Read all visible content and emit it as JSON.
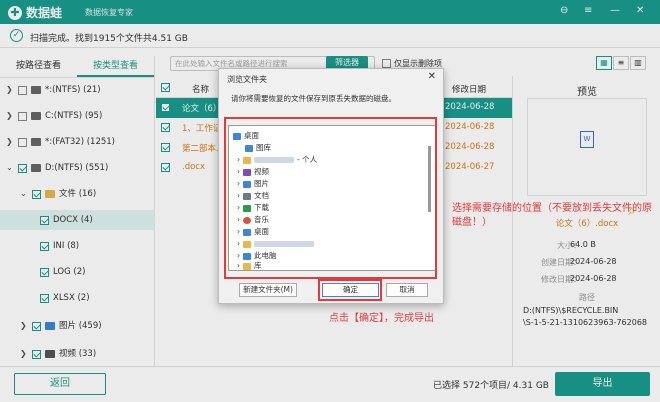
{
  "app": {
    "name": "数据蛙",
    "subtitle": "数据恢复专家"
  },
  "window_controls": [
    "⊖",
    "≡",
    "—",
    "✕"
  ],
  "status": {
    "text": "扫描完成。找到1915个文件共4.51 GB"
  },
  "left_tabs": [
    "按路径查看",
    "按类型查看"
  ],
  "tree": [
    {
      "label": "*:(NTFS) (21)",
      "checked": false
    },
    {
      "label": "C:(NTFS) (95)",
      "checked": false
    },
    {
      "label": "*:(FAT32) (1251)",
      "checked": false
    },
    {
      "label": "D:(NTFS) (551)",
      "checked": true
    },
    {
      "label": "文件 (16)",
      "checked": true
    },
    {
      "label": "DOCX (4)",
      "checked": true
    },
    {
      "label": "INI (8)",
      "checked": true
    },
    {
      "label": "LOG (2)",
      "checked": true
    },
    {
      "label": "XLSX (2)",
      "checked": true
    },
    {
      "label": "图片 (459)",
      "checked": true
    },
    {
      "label": "视频 (33)",
      "checked": true
    }
  ],
  "toolbar": {
    "search_placeholder": "在此处输入文件名或路径进行搜索",
    "filter_label": "筛选器",
    "show_deleted_label": "仅显示删除项"
  },
  "file_header": {
    "name": "名称",
    "modified": "修改日期"
  },
  "files": [
    {
      "name": "论文（6）",
      "date": "2024-06-28",
      "selected": true
    },
    {
      "name": "1、工作证...",
      "date": "2024-06-28",
      "selected": false
    },
    {
      "name": "第二部本...",
      "date": "2024-06-28",
      "selected": false
    },
    {
      "name": ".docx",
      "date": "2024-06-27",
      "selected": false
    }
  ],
  "preview": {
    "title": "预览",
    "file_name": "论文（6）.docx",
    "meta": [
      {
        "label": "大小：",
        "value": "64.0  B"
      },
      {
        "label": "创建日期：",
        "value": "2024-06-28"
      },
      {
        "label": "修改日期：",
        "value": "2024-06-28"
      }
    ],
    "path_label": "路径",
    "path_lines": [
      "D:(NTFS)\\$RECYCLE.BIN",
      "\\S-1-5-21-1310623963-762068"
    ]
  },
  "bottom": {
    "back_label": "返回",
    "selection_info": "已选择 572个项目/ 4.31 GB",
    "export_label": "导出"
  },
  "dialog": {
    "title": "浏览文件夹",
    "message": "请你将需要恢复的文件保存到原丢失数据的磁盘。",
    "tree_items": [
      {
        "label": "桌面",
        "indent": 0,
        "arrow": "",
        "icon_color": "#3b86d6"
      },
      {
        "label": "图库",
        "indent": 1,
        "arrow": "",
        "icon_color": "#3b86d6"
      },
      {
        "label": "- 个人",
        "indent": 1,
        "arrow": "›",
        "icon_color": "#e8b84a"
      },
      {
        "label": "视频",
        "indent": 1,
        "arrow": "›",
        "icon_color": "#7a4fbf"
      },
      {
        "label": "图片",
        "indent": 1,
        "arrow": "›",
        "icon_color": "#3b86d6"
      },
      {
        "label": "文档",
        "indent": 1,
        "arrow": "›",
        "icon_color": "#6a7a8a"
      },
      {
        "label": "下载",
        "indent": 1,
        "arrow": "›",
        "icon_color": "#2a9d4a"
      },
      {
        "label": "音乐",
        "indent": 1,
        "arrow": "›",
        "icon_color": "#d6553b"
      },
      {
        "label": "桌面",
        "indent": 1,
        "arrow": "›",
        "icon_color": "#3b86d6"
      },
      {
        "label": "",
        "indent": 1,
        "arrow": "›",
        "icon_color": "#e8b84a"
      },
      {
        "label": "此电脑",
        "indent": 1,
        "arrow": "›",
        "icon_color": "#3b86d6"
      },
      {
        "label": "库",
        "indent": 1,
        "arrow": "›",
        "icon_color": "#e8b84a"
      }
    ],
    "new_folder_label": "新建文件夹(M)",
    "ok_label": "确定",
    "cancel_label": "取消"
  },
  "annotations": {
    "location_note": "选择需要存储的位置（不要放到丢失文件的原磁盘！）",
    "confirm_note": "点击【确定】，完成导出"
  }
}
